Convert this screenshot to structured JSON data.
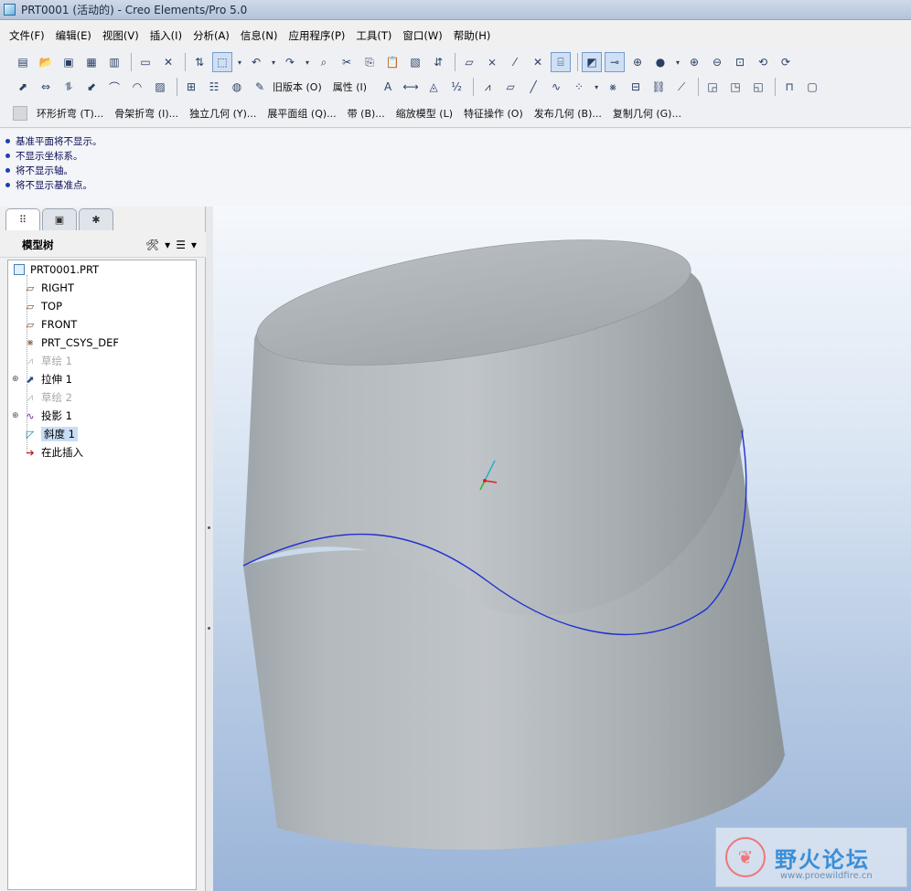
{
  "window": {
    "title": "PRT0001 (活动的) - Creo Elements/Pro 5.0"
  },
  "menu": [
    "文件(F)",
    "编辑(E)",
    "视图(V)",
    "插入(I)",
    "分析(A)",
    "信息(N)",
    "应用程序(P)",
    "工具(T)",
    "窗口(W)",
    "帮助(H)"
  ],
  "toolbar": {
    "old_version_label": "旧版本 (O)",
    "properties_label": "属性 (I)",
    "feature_bar": [
      "环形折弯 (T)...",
      "骨架折弯 (I)...",
      "独立几何 (Y)...",
      "展平面组 (Q)...",
      "带 (B)...",
      "缩放模型 (L)",
      "特征操作 (O)",
      "发布几何 (B)...",
      "复制几何 (G)..."
    ]
  },
  "messages": [
    "基准平面将不显示。",
    "不显示坐标系。",
    "将不显示轴。",
    "将不显示基准点。"
  ],
  "model_tree": {
    "title": "模型树",
    "items": [
      {
        "label": "PRT0001.PRT",
        "icon": "part-icon",
        "dim": false
      },
      {
        "label": "RIGHT",
        "icon": "datum-plane-icon",
        "dim": false
      },
      {
        "label": "TOP",
        "icon": "datum-plane-icon",
        "dim": false
      },
      {
        "label": "FRONT",
        "icon": "datum-plane-icon",
        "dim": false
      },
      {
        "label": "PRT_CSYS_DEF",
        "icon": "csys-icon",
        "dim": false
      },
      {
        "label": "草绘 1",
        "icon": "sketch-icon",
        "dim": true
      },
      {
        "label": "拉伸 1",
        "icon": "extrude-icon",
        "dim": false,
        "expandable": true
      },
      {
        "label": "草绘 2",
        "icon": "sketch-icon",
        "dim": true
      },
      {
        "label": "投影 1",
        "icon": "project-icon",
        "dim": false,
        "expandable": true
      },
      {
        "label": "斜度 1",
        "icon": "draft-icon",
        "dim": false,
        "selected": true
      },
      {
        "label": "在此插入",
        "icon": "insert-here-arrow-icon",
        "dim": false
      }
    ]
  },
  "watermark": {
    "title": "野火论坛",
    "url": "www.proewildfire.cn"
  },
  "colors": {
    "model_gray": "#a9b0b4",
    "curve_blue": "#1f2fd0",
    "viewport_top": "#f5f8fc",
    "viewport_bottom": "#9bb5d9"
  }
}
